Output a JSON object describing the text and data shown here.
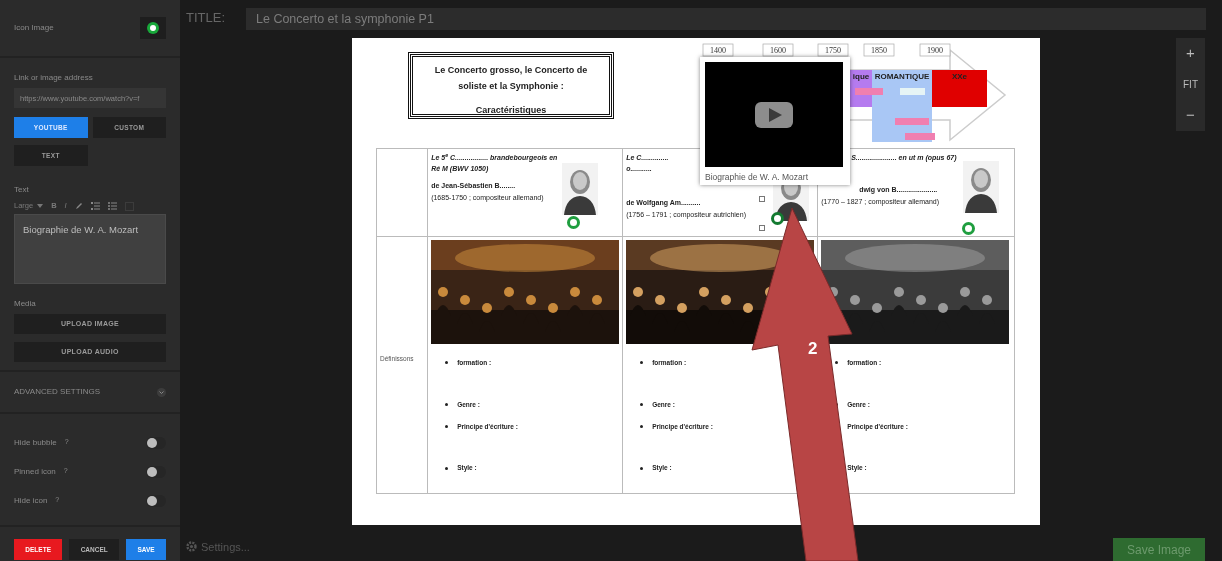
{
  "sidebar": {
    "icon_image": {
      "label": "Icon Image"
    },
    "link": {
      "label": "Link or image address",
      "value": "https://www.youtube.com/watch?v=f"
    },
    "source_buttons": [
      {
        "label": "YOUTUBE",
        "selected": true
      },
      {
        "label": "CUSTOM",
        "selected": false
      },
      {
        "label": "TEXT",
        "selected": false
      }
    ],
    "text": {
      "label": "Text",
      "size": "Large",
      "bold_label": "B",
      "italic_label": "I",
      "value": "Biographie de W. A. Mozart"
    },
    "media": {
      "label": "Media",
      "buttons": [
        "UPLOAD IMAGE",
        "UPLOAD AUDIO"
      ]
    },
    "advanced": {
      "label": "ADVANCED SETTINGS",
      "expanded": false
    },
    "options": [
      {
        "label": "Hide bubble",
        "help": "?",
        "on": false
      },
      {
        "label": "Pinned icon",
        "help": "?",
        "on": false
      },
      {
        "label": "Hide icon",
        "help": "?",
        "on": false
      }
    ],
    "actions": [
      {
        "label": "DELETE",
        "kind": "danger"
      },
      {
        "label": "CANCEL",
        "kind": "neutral"
      },
      {
        "label": "SAVE",
        "kind": "primary"
      }
    ]
  },
  "title": {
    "label": "TITLE:",
    "value": "Le Concerto et la symphonie P1"
  },
  "zoom_controls": [
    "+",
    "FIT",
    "−"
  ],
  "document": {
    "heading_lines": [
      "Le Concerto grosso,  le Concerto de",
      "soliste et la Symphonie :",
      "Caractéristiques"
    ],
    "timeline": {
      "years": [
        "1400",
        "1600",
        "1750",
        "1850",
        "1900"
      ],
      "periods": [
        {
          "label": "ique",
          "color": "#b57bef"
        },
        {
          "label": "ROMANTIQUE",
          "color": "#a9c7f5"
        },
        {
          "label": "XXe",
          "color": "#e00000"
        }
      ]
    },
    "table": {
      "row_label": "Définissons",
      "columns": [
        {
          "work": "Le 5$^{e}$ C................. brandebourgeois en Ré M (BWV 1050)",
          "composer": "de Jean-Sébastien B........",
          "dates": "(1685-1750 ; compositeur allemand)",
          "hotspot": {
            "selected": false
          },
          "topics": [
            "formation :",
            "Genre :",
            "Principe d'écriture :",
            "Style :"
          ]
        },
        {
          "work": "Le C.............. o...........",
          "composer": "de Wolfgang Am..........",
          "dates": "(1756 – 1791 ; compositeur autrichien)",
          "hotspot": {
            "selected": true
          },
          "topics": [
            "formation :",
            "Genre :",
            "Principe d'écriture :",
            "Style :"
          ]
        },
        {
          "work": "S..................... en ut m (opus 67)",
          "composer": "dwig von B.....................",
          "dates": "(1770 – 1827 ; compositeur allemand)",
          "hotspot": {
            "selected": false
          },
          "topics": [
            "formation :",
            "Genre :",
            "Principe d'écriture :",
            "Style :"
          ]
        }
      ]
    }
  },
  "popup": {
    "caption": "Biographie de W. A. Mozart"
  },
  "annotation": {
    "label": "2"
  },
  "footer": {
    "settings": "Settings...",
    "save": "Save Image"
  }
}
